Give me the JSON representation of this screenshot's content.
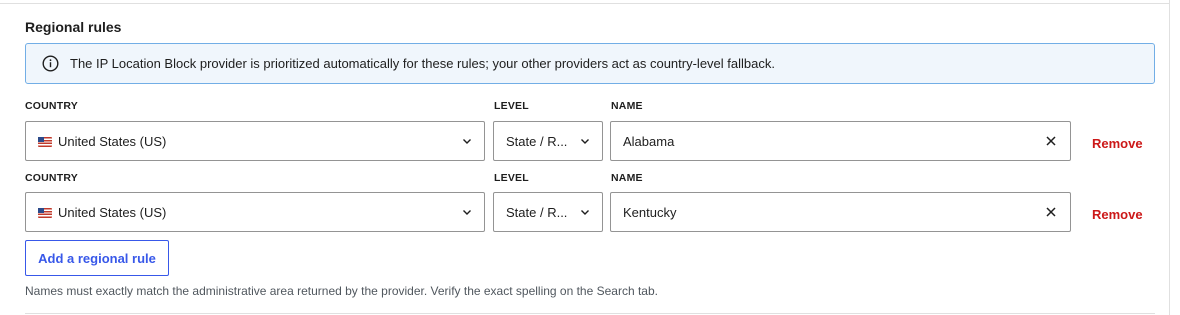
{
  "section": {
    "title": "Regional rules"
  },
  "notice": {
    "icon": "info-icon",
    "text": "The IP Location Block provider is prioritized automatically for these rules; your other providers act as country-level fallback.",
    "border_color": "#72aee6",
    "background": "#f0f6fc"
  },
  "rules": [
    {
      "country_label": "COUNTRY",
      "level_label": "LEVEL",
      "name_label": "NAME",
      "country_value": "United States (US)",
      "level_value": "State / R...",
      "name_value": "Alabama",
      "remove_label": "Remove"
    },
    {
      "country_label": "COUNTRY",
      "level_label": "LEVEL",
      "name_label": "NAME",
      "country_value": "United States (US)",
      "level_value": "State / R...",
      "name_value": "Kentucky",
      "remove_label": "Remove"
    }
  ],
  "add_button": {
    "label": "Add a regional rule"
  },
  "help": {
    "text": "Names must exactly match the administrative area returned by the provider. Verify the exact spelling on the Search tab."
  },
  "colors": {
    "accent": "#3858e9",
    "danger": "#cc1818",
    "border": "#949494"
  }
}
